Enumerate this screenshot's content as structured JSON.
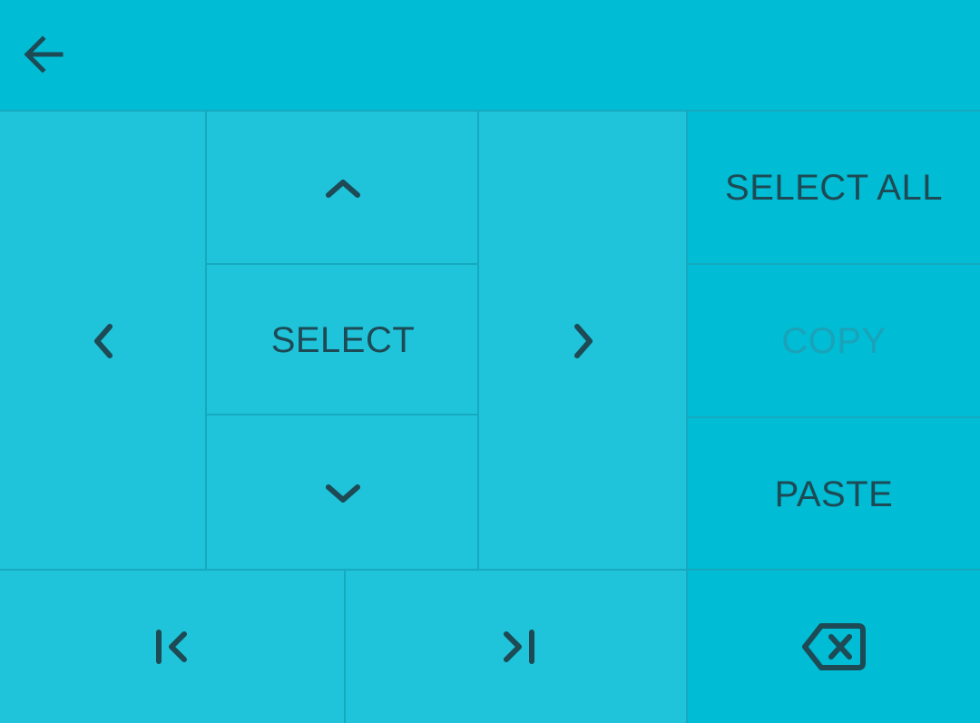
{
  "topbar": {
    "back_icon": "arrow-left-icon"
  },
  "nav": {
    "up_icon": "chevron-up-icon",
    "down_icon": "chevron-down-icon",
    "left_icon": "chevron-left-icon",
    "right_icon": "chevron-right-icon",
    "select_label": "SELECT"
  },
  "actions": {
    "select_all_label": "SELECT ALL",
    "copy_label": "COPY",
    "paste_label": "PASTE",
    "copy_disabled": true
  },
  "bottom": {
    "home_icon": "jump-to-start-icon",
    "end_icon": "jump-to-end-icon",
    "backspace_icon": "backspace-icon"
  },
  "colors": {
    "background": "#1fc3da",
    "accent": "#00bcd4",
    "icon": "#1d4a54",
    "disabled_text": "#1aa3b8",
    "divider": "#16a9bf"
  }
}
